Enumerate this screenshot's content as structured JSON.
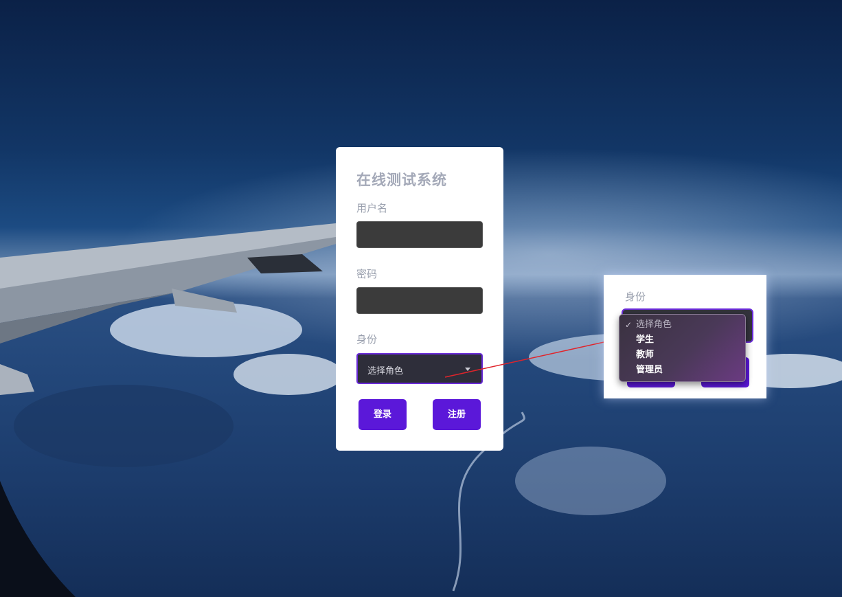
{
  "login": {
    "title": "在线测试系统",
    "username_label": "用户名",
    "password_label": "密码",
    "role_label": "身份",
    "role_select": {
      "selected": "选择角色"
    },
    "login_button": "登录",
    "register_button": "注册"
  },
  "dropdown_zoom": {
    "role_label": "身份",
    "options": [
      {
        "label": "选择角色",
        "selected": true
      },
      {
        "label": "学生",
        "selected": false
      },
      {
        "label": "教师",
        "selected": false
      },
      {
        "label": "管理员",
        "selected": false
      }
    ]
  },
  "colors": {
    "accent": "#5b18d9",
    "select_border": "#6a2bd9",
    "annotation_arrow": "#e0242b",
    "input_bg": "#3b3b3b"
  }
}
